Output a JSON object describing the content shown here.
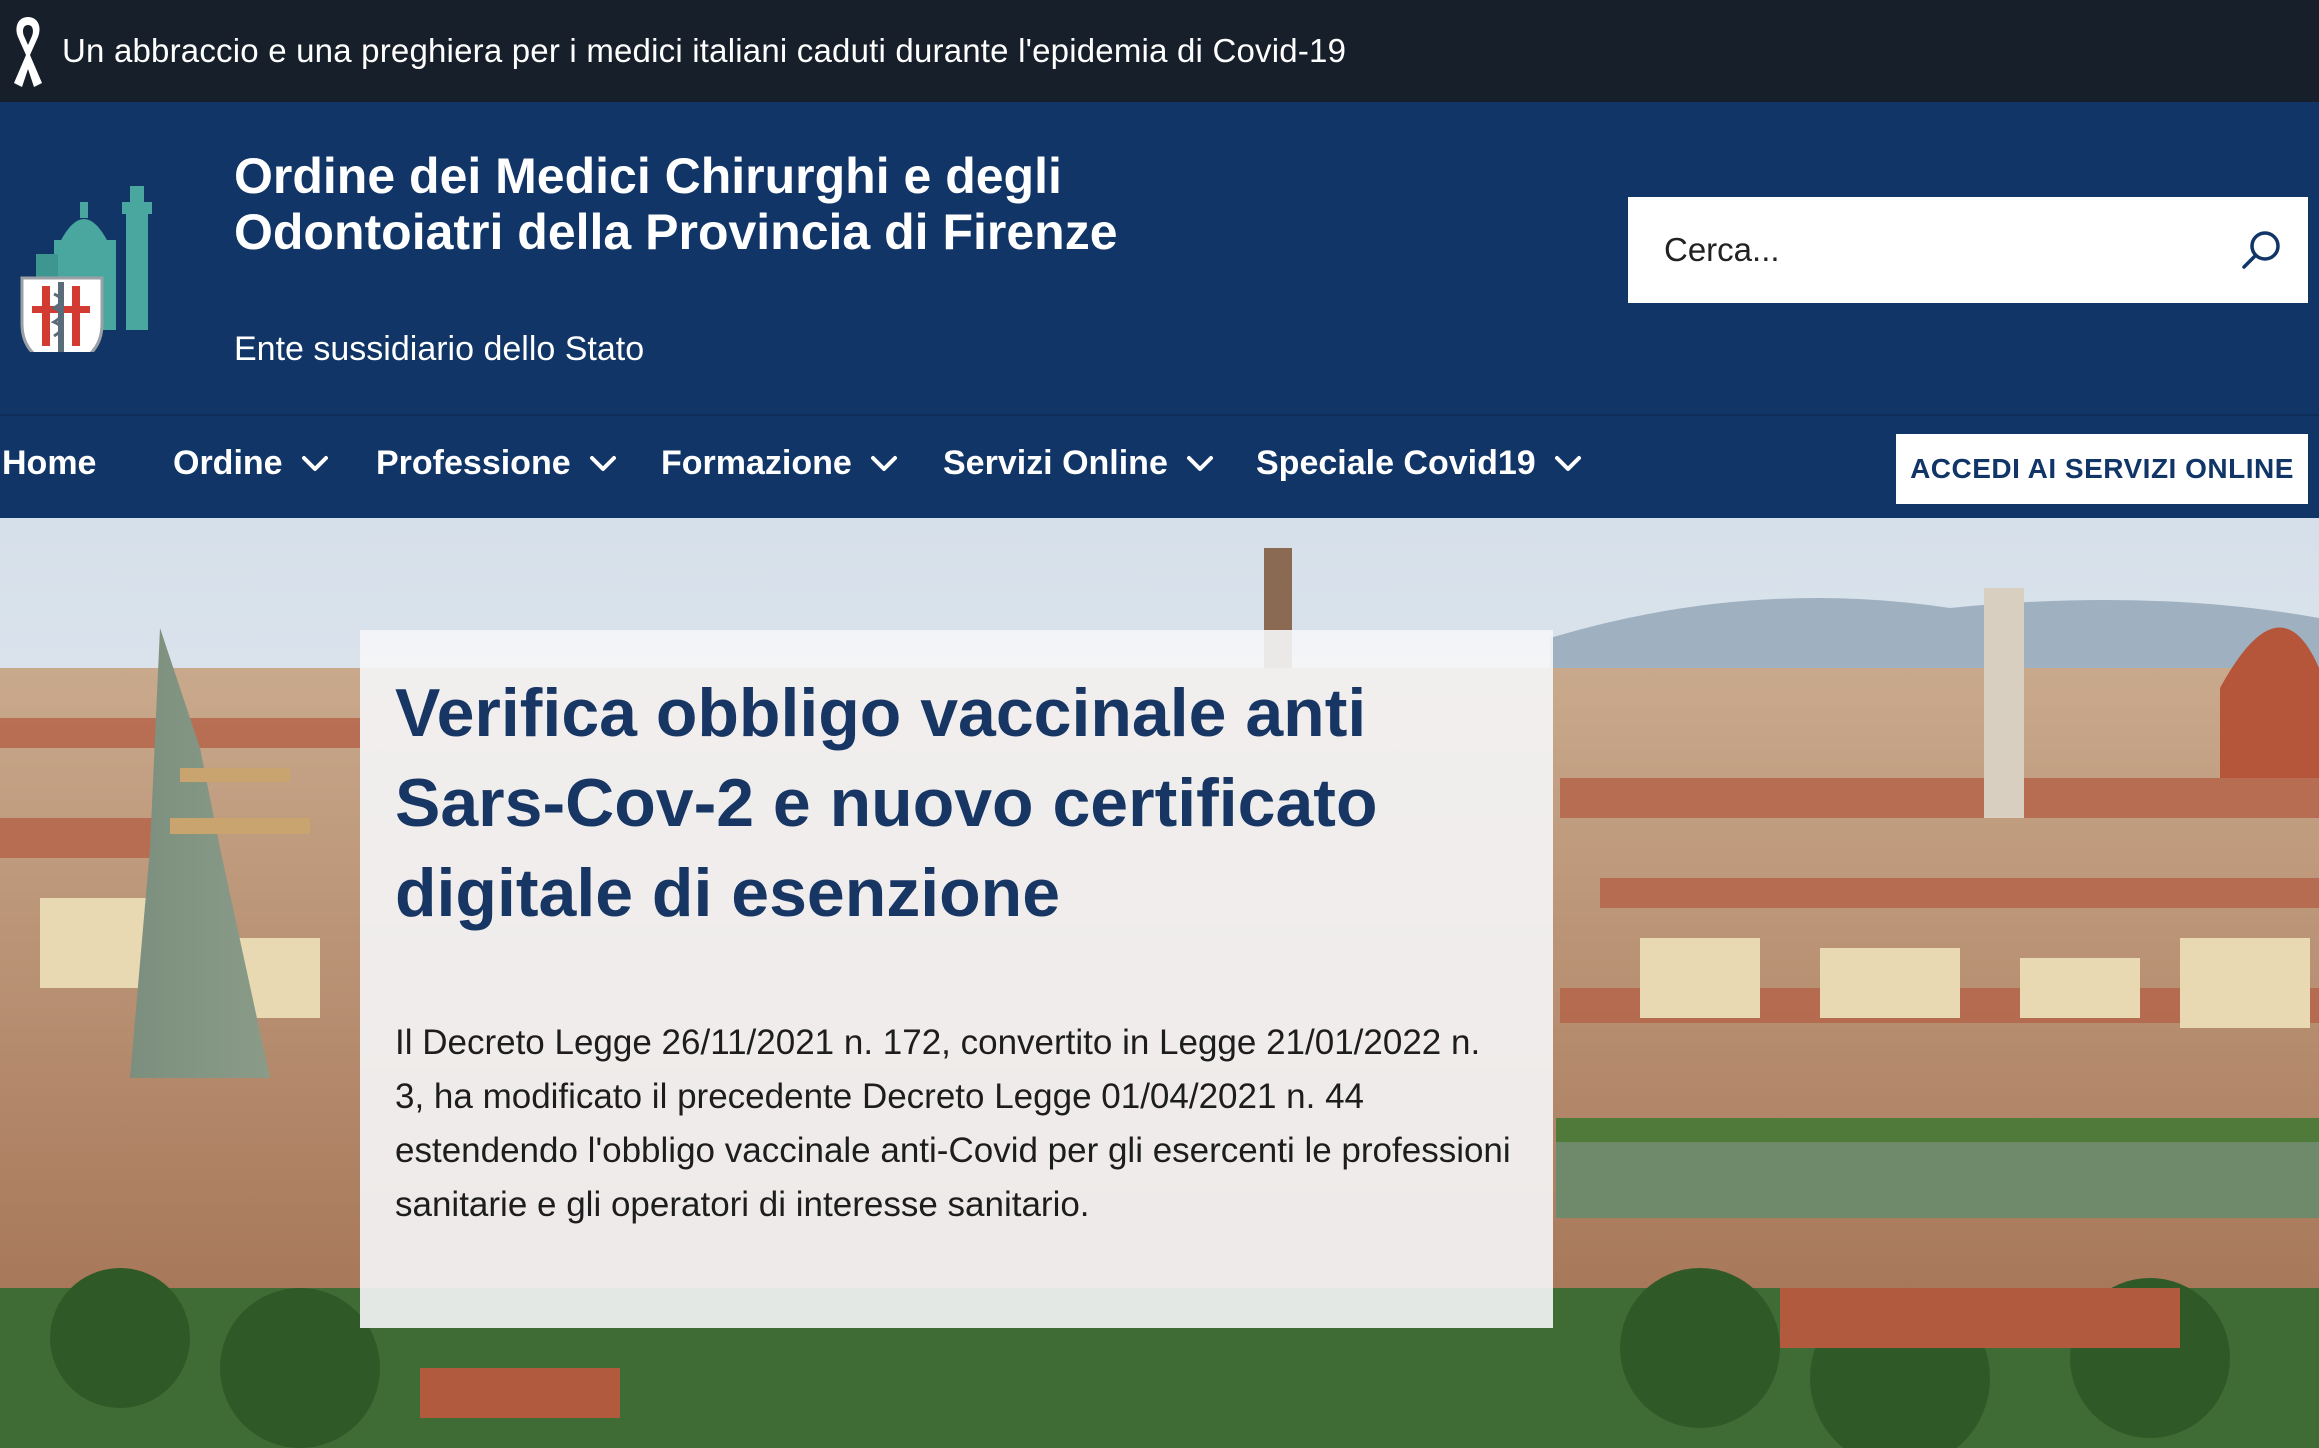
{
  "top_banner": {
    "message": "Un abbraccio e una preghiera per i medici italiani caduti durante l'epidemia di Covid-19"
  },
  "header": {
    "title": "Ordine dei Medici Chirurghi e degli Odontoiatri della Provincia di Firenze",
    "subtitle": "Ente sussidiario dello Stato",
    "search": {
      "placeholder": "Cerca..."
    }
  },
  "nav": {
    "items": [
      {
        "label": "Home"
      },
      {
        "label": "Ordine"
      },
      {
        "label": "Professione"
      },
      {
        "label": "Formazione"
      },
      {
        "label": "Servizi Online"
      },
      {
        "label": "Speciale Covid19"
      }
    ],
    "cta_label": "ACCEDI AI SERVIZI ONLINE"
  },
  "hero": {
    "heading": "Verifica obbligo vaccinale anti Sars-Cov-2 e nuovo certificato digitale di esenzione",
    "body": "Il Decreto Legge 26/11/2021 n. 172, convertito in Legge 21/01/2022 n. 3, ha modificato il precedente Decreto Legge 01/04/2021 n. 44 estendendo l'obbligo vaccinale anti-Covid per gli esercenti le professioni sanitarie e gli operatori di interesse sanitario."
  },
  "colors": {
    "brand_blue": "#113567",
    "banner_dark": "#17202a",
    "heading_blue": "#173664",
    "logo_teal": "#4aa7a0"
  },
  "icons": {
    "ribbon": "mourning-ribbon-icon",
    "search": "search-icon",
    "chevron": "chevron-down-icon"
  }
}
